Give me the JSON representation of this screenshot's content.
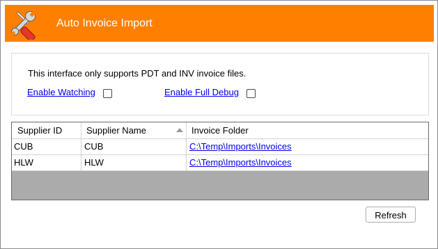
{
  "window": {
    "title": "Auto Invoice Import",
    "icon": "tools-icon",
    "accent_color": "#ff8000"
  },
  "options": {
    "info_text": "This interface only supports PDT and INV invoice files.",
    "enable_watching_label": "Enable Watching",
    "enable_watching_checked": false,
    "enable_full_debug_label": "Enable Full Debug",
    "enable_full_debug_checked": false
  },
  "grid": {
    "columns": [
      "Supplier ID",
      "Supplier Name",
      "Invoice Folder"
    ],
    "sorted_column": "Supplier Name",
    "rows": [
      {
        "supplier_id": "CUB",
        "supplier_name": "CUB",
        "invoice_folder": "C:\\Temp\\Imports\\Invoices"
      },
      {
        "supplier_id": "HLW",
        "supplier_name": "HLW",
        "invoice_folder": "C:\\Temp\\Imports\\Invoices"
      }
    ]
  },
  "actions": {
    "refresh_label": "Refresh"
  }
}
